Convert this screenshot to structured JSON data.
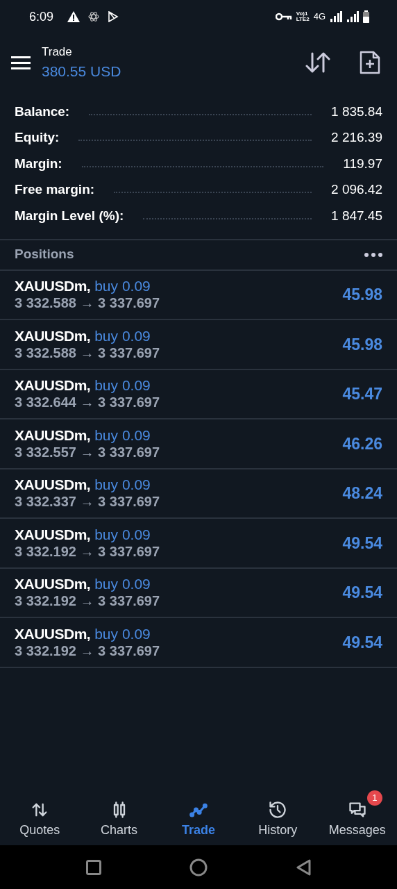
{
  "status_bar": {
    "time": "6:09",
    "volte_top": "Vo)1",
    "volte_bottom": "LTE2",
    "network": "4G"
  },
  "header": {
    "title": "Trade",
    "balance": "380.55 USD"
  },
  "summary": [
    {
      "label": "Balance:",
      "value": "1 835.84"
    },
    {
      "label": "Equity:",
      "value": "2 216.39"
    },
    {
      "label": "Margin:",
      "value": "119.97"
    },
    {
      "label": "Free margin:",
      "value": "2 096.42"
    },
    {
      "label": "Margin Level (%):",
      "value": "1 847.45"
    }
  ],
  "positions": {
    "title": "Positions",
    "rows": [
      {
        "symbol": "XAUUSDm,",
        "order": "buy 0.09",
        "prices": "3 332.588 → 3 337.697",
        "profit": "45.98"
      },
      {
        "symbol": "XAUUSDm,",
        "order": "buy 0.09",
        "prices": "3 332.588 → 3 337.697",
        "profit": "45.98"
      },
      {
        "symbol": "XAUUSDm,",
        "order": "buy 0.09",
        "prices": "3 332.644 → 3 337.697",
        "profit": "45.47"
      },
      {
        "symbol": "XAUUSDm,",
        "order": "buy 0.09",
        "prices": "3 332.557 → 3 337.697",
        "profit": "46.26"
      },
      {
        "symbol": "XAUUSDm,",
        "order": "buy 0.09",
        "prices": "3 332.337 → 3 337.697",
        "profit": "48.24"
      },
      {
        "symbol": "XAUUSDm,",
        "order": "buy 0.09",
        "prices": "3 332.192 → 3 337.697",
        "profit": "49.54"
      },
      {
        "symbol": "XAUUSDm,",
        "order": "buy 0.09",
        "prices": "3 332.192 → 3 337.697",
        "profit": "49.54"
      },
      {
        "symbol": "XAUUSDm,",
        "order": "buy 0.09",
        "prices": "3 332.192 → 3 337.697",
        "profit": "49.54"
      }
    ]
  },
  "nav": [
    {
      "kind": "quotes",
      "label": "Quotes",
      "selected": false
    },
    {
      "kind": "charts",
      "label": "Charts",
      "selected": false
    },
    {
      "kind": "trade",
      "label": "Trade",
      "selected": true
    },
    {
      "kind": "history",
      "label": "History",
      "selected": false
    },
    {
      "kind": "messages",
      "label": "Messages",
      "selected": false,
      "badge": "1"
    }
  ]
}
